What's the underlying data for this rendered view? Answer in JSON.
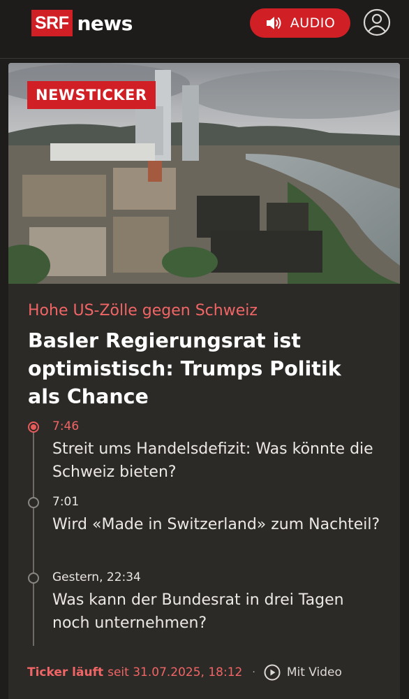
{
  "header": {
    "logo_box": "SRF",
    "logo_text": "news",
    "audio_label": "AUDIO",
    "audio_icon": "speaker-icon",
    "profile_icon": "user-profile-icon"
  },
  "article": {
    "badge": "NEWSTICKER",
    "kicker": "Hohe US-Zölle gegen Schweiz",
    "headline": "Basler Regierungsrat ist optimistisch: Trumps Politik als Chance",
    "image_alt_subject": "Basel city skyline photo",
    "timeline": [
      {
        "time": "7:46",
        "text": "Streit ums Handelsdefizit: Was könnte die Schweiz bieten?",
        "active": true
      },
      {
        "time": "7:01",
        "text": "Wird «Made in Switzerland» zum Nachteil?",
        "active": false
      },
      {
        "time": "Gestern, 22:34",
        "text": "Was kann der Bundesrat in drei Tagen noch unternehmen?",
        "active": false
      }
    ],
    "footer": {
      "ticker_status": "Ticker läuft",
      "since": "seit 31.07.2025, 18:12",
      "separator": "·",
      "video_label": "Mit Video",
      "video_icon": "play-circle-icon"
    }
  },
  "colors": {
    "brand_red": "#d11f26",
    "accent_red_text": "#f06565",
    "background": "#1f1d1b",
    "card": "#2c2a27"
  }
}
